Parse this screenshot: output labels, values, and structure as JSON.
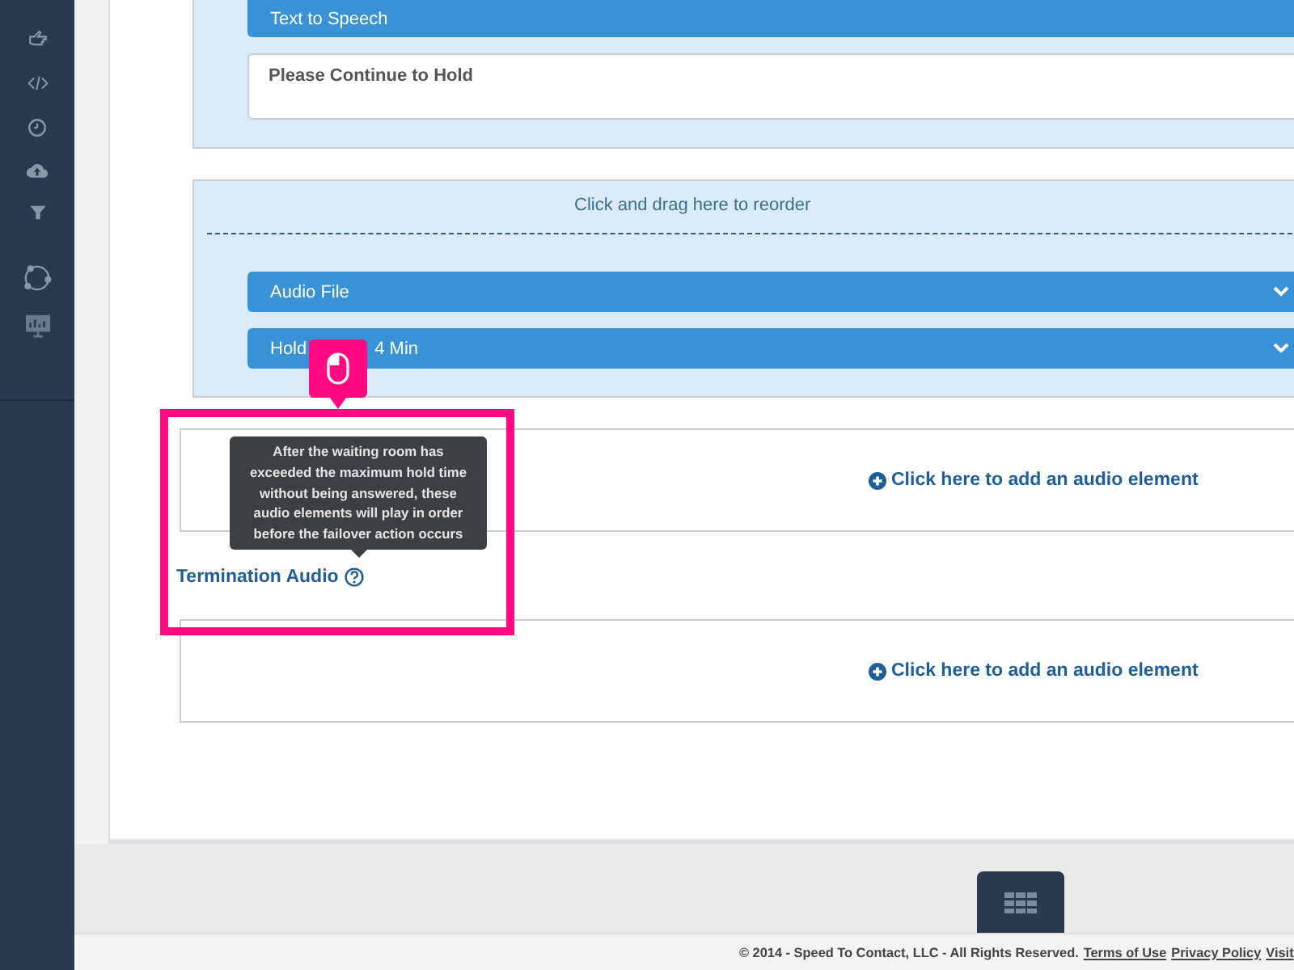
{
  "panels": [
    {
      "bars": [
        {
          "label": "Text to Speech",
          "chevron": false
        }
      ],
      "message": "Please Continue to Hold"
    },
    {
      "drag_hint": "Click and drag here to reorder",
      "bars": [
        {
          "label": "Audio File",
          "chevron": true
        },
        {
          "label_parts": [
            "Hold",
            "4 Min"
          ],
          "chevron": true
        }
      ]
    }
  ],
  "sections": [
    {
      "add_link": "Click here to add an audio element"
    },
    {
      "title": "Termination Audio",
      "add_link": "Click here to add an audio element"
    }
  ],
  "tooltip": "After the waiting room has exceeded the maximum hold time without being answered, these audio elements will play in order before the failover action occurs",
  "footer": {
    "copyright": "© 2014 - Speed To Contact, LLC - All Rights Reserved.",
    "links": [
      "Terms of Use",
      "Privacy Policy",
      "Visit"
    ]
  }
}
